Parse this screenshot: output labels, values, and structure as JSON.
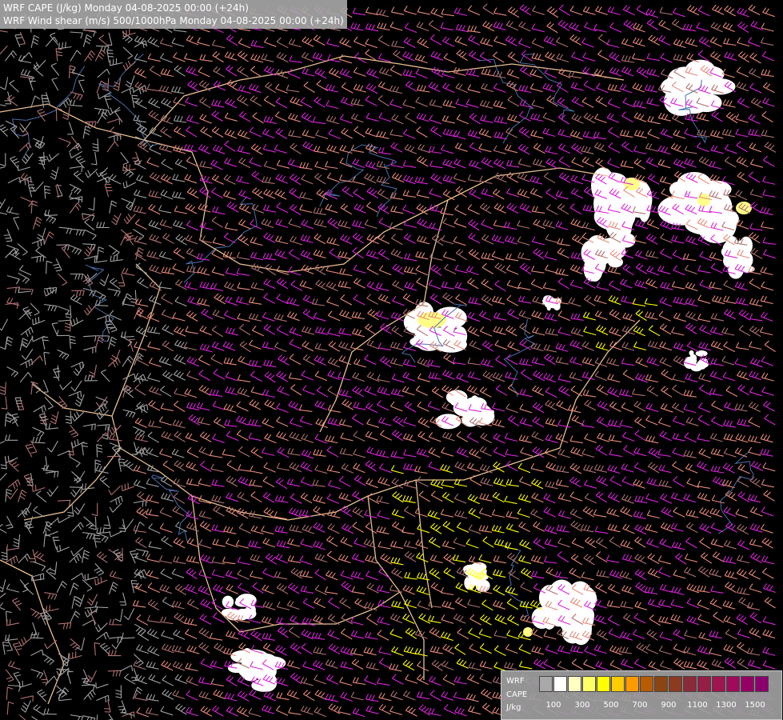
{
  "header": {
    "line1": "WRF CAPE (J/kg) Monday 04-08-2025 00:00 (+24h)",
    "line2": "WRF Wind shear (m/s) 500/1000hPa Monday 04-08-2025 00:00 (+24h)"
  },
  "legend": {
    "label_wrf": "WRF",
    "label_cape": "CAPE",
    "label_unit": "J/kg",
    "ticks": [
      "100",
      "300",
      "500",
      "700",
      "900",
      "1100",
      "1300",
      "1500"
    ],
    "colors": [
      "#a8a8a8",
      "#ffffff",
      "#ffffc0",
      "#ffff66",
      "#ffff00",
      "#ffcc00",
      "#ff9900",
      "#b85c00",
      "#8b4513",
      "#8c3a20",
      "#8c2a3a",
      "#961e46",
      "#a01450",
      "#a00a5a",
      "#960064",
      "#8c006e"
    ]
  },
  "map": {
    "barb_colors": {
      "gray": "#a0a0a0",
      "salmon": "#e88a7a",
      "magenta": "#dd22dd",
      "yellow": "#ffff00",
      "brown": "#b07070"
    },
    "cape_colors": {
      "low": "#ffffff",
      "mid": "#ffff88",
      "high": "#ffee00"
    },
    "border_color": "#e8c090",
    "river_color": "#4a6fa8"
  }
}
